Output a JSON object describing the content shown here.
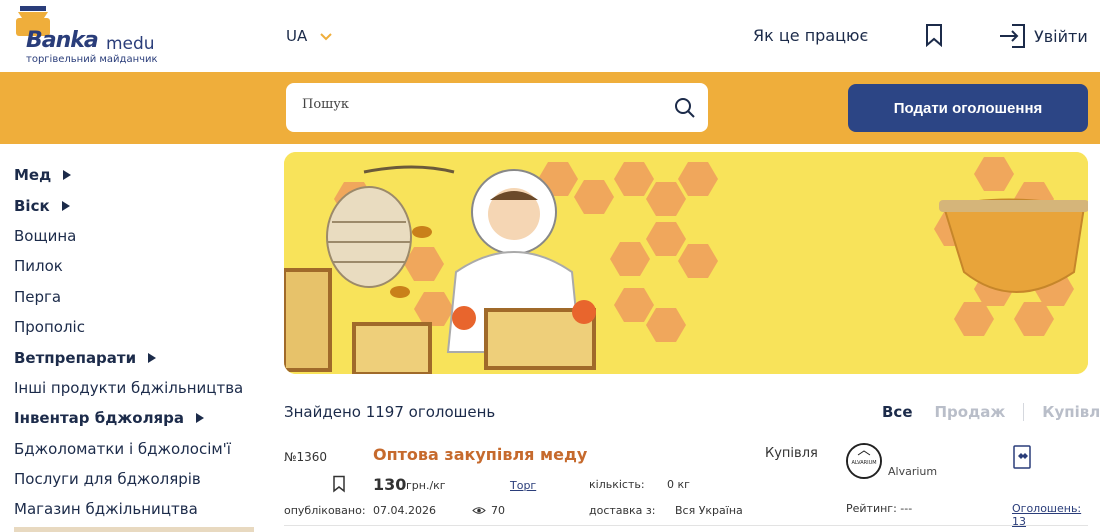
{
  "header": {
    "logo_word_main": "Banka",
    "logo_word_sub": "medu",
    "logo_tagline": "торгівельний майданчик",
    "language": "UA",
    "how_it_works": "Як це працює",
    "login": "Увійти"
  },
  "search": {
    "placeholder": "Пошук",
    "post_button": "Подати оголошення"
  },
  "sidebar": {
    "items": [
      {
        "label": "Мед",
        "has_submenu": true
      },
      {
        "label": "Віск",
        "has_submenu": true
      },
      {
        "label": "Вощина",
        "has_submenu": false
      },
      {
        "label": "Пилок",
        "has_submenu": false
      },
      {
        "label": "Перга",
        "has_submenu": false
      },
      {
        "label": "Прополіс",
        "has_submenu": false
      },
      {
        "label": "Ветпрепарати",
        "has_submenu": true
      },
      {
        "label": "Інші продукти бджільництва",
        "has_submenu": false
      },
      {
        "label": "Інвентар бджоляра",
        "has_submenu": true
      },
      {
        "label": "Бджоломатки і бджолосім'ї",
        "has_submenu": false
      },
      {
        "label": "Послуги для бджолярів",
        "has_submenu": false
      },
      {
        "label": "Магазин бджільництва",
        "has_submenu": false
      }
    ]
  },
  "results": {
    "found_text": "Знайдено 1197 оголошень",
    "filters": {
      "all": "Все",
      "sale": "Продаж",
      "buy": "Купівля"
    }
  },
  "listing": {
    "number": "№1360",
    "title": "Оптова закупівля меду",
    "type": "Купівля",
    "price": "130",
    "unit": "грн./кг",
    "torg": "Торг",
    "qty_label": "кількість:",
    "qty_value": "0 кг",
    "published_label": "опубліковано:",
    "published_date": "07.04.2026",
    "views": "70",
    "delivery_label": "доставка з:",
    "delivery_value": "Вся Україна",
    "seller": "Alvarium",
    "seller_logo_text": "ALVARIUM",
    "rating": "Рейтинг:  ---",
    "ads_count": "Оголошень: 13"
  },
  "colors": {
    "accent_band": "#efae3b",
    "primary_button": "#2c4585",
    "title_orange": "#c66a2d",
    "text_navy": "#1c2b4a"
  }
}
